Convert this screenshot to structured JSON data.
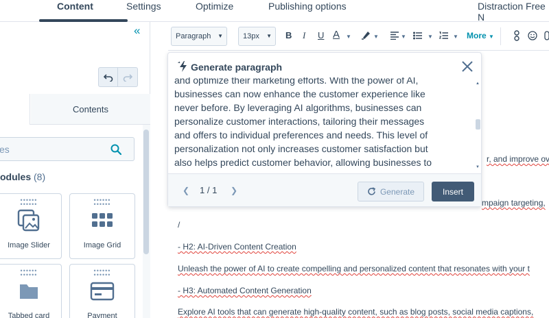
{
  "nav": {
    "tabs": [
      {
        "label": "Content",
        "active": true
      },
      {
        "label": "Settings",
        "active": false
      },
      {
        "label": "Optimize",
        "active": false
      },
      {
        "label": "Publishing options",
        "active": false
      }
    ],
    "right_label": "Distraction Free N"
  },
  "left_panel": {
    "collapse_icon": "double-chevron-left-icon",
    "tab_contents": "Contents",
    "search_placeholder": "es",
    "modules_title": "odules",
    "modules_count": "(8)",
    "cards": [
      {
        "label": "Image Slider",
        "icon": "image-slider-icon"
      },
      {
        "label": "Image Grid",
        "icon": "image-grid-icon"
      },
      {
        "label": "Tabbed card",
        "icon": "folder-icon"
      },
      {
        "label": "Payment",
        "icon": "credit-card-icon"
      }
    ]
  },
  "toolbar": {
    "paragraph_select": "Paragraph",
    "size_select": "13px",
    "bold": "B",
    "italic": "I",
    "underline": "U",
    "font_color": "A",
    "more": "More"
  },
  "editor": {
    "lines": [
      "r, and improve ov",
      "mpaign targeting,",
      "/",
      "- H2: AI-Driven Content Creation",
      "Unleash the power of AI to create compelling and personalized content that resonates with your t",
      "- H3: Automated Content Generation",
      "Explore AI tools that can generate high-quality content, such as blog posts, social media captions,"
    ]
  },
  "modal": {
    "title": "Generate paragraph",
    "text_lines": [
      "and optimize their marketing efforts. With the power of AI,",
      "businesses can now enhance the customer experience like",
      "never before. By leveraging AI algorithms, businesses can",
      "personalize customer interactions, tailoring their messages",
      "and offers to individual preferences and needs. This level of",
      "personalization not only increases customer satisfaction but",
      "also helps predict customer behavior, allowing businesses to"
    ],
    "pagination": "1 / 1",
    "generate_label": "Generate",
    "insert_label": "Insert"
  },
  "colors": {
    "text": "#33475b",
    "accent": "#0091ae",
    "insert_button": "#425b76",
    "spellcheck": "#e0413a"
  }
}
